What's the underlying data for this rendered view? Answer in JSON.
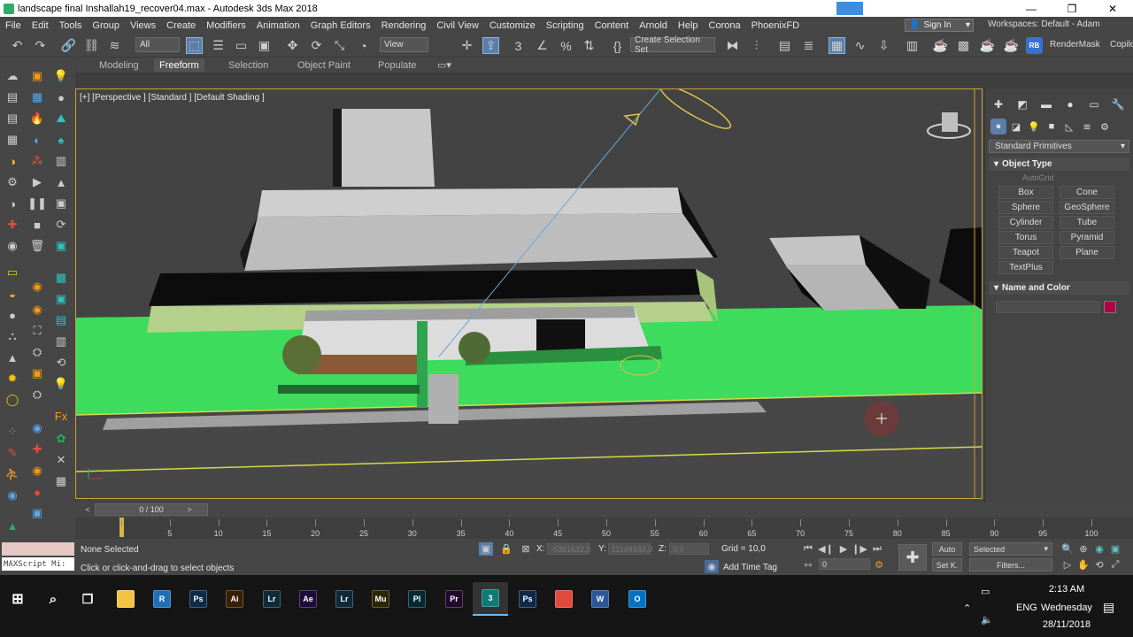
{
  "window": {
    "title": "landscape final Inshallah19_recover04.max - Autodesk 3ds Max 2018",
    "min": "—",
    "max": "❐",
    "close": "✕"
  },
  "menu": {
    "items": [
      "File",
      "Edit",
      "Tools",
      "Group",
      "Views",
      "Create",
      "Modifiers",
      "Animation",
      "Graph Editors",
      "Rendering",
      "Civil View",
      "Customize",
      "Scripting",
      "Content",
      "Arnold",
      "Help",
      "Corona",
      "PhoenixFD"
    ],
    "sign_in": "Sign In",
    "workspaces": "Workspaces: Default - Adam"
  },
  "toolbar": {
    "filter": "All",
    "view": "View",
    "selection_set": "Create Selection Set",
    "render_mask": "RenderMask",
    "copilot": "Copilo"
  },
  "ribbon": {
    "tabs": [
      "Modeling",
      "Freeform",
      "Selection",
      "Object Paint",
      "Populate"
    ]
  },
  "viewport": {
    "label": "[+] [Perspective ] [Standard ] [Default Shading ]",
    "ground_color": "#3ddc5c"
  },
  "command_panel": {
    "category": "Standard Primitives",
    "object_type": "Object Type",
    "autogrid": "AutoGrid",
    "buttons": [
      "Box",
      "Cone",
      "Sphere",
      "GeoSphere",
      "Cylinder",
      "Tube",
      "Torus",
      "Pyramid",
      "Teapot",
      "Plane",
      "TextPlus"
    ],
    "name_and_color": "Name and Color",
    "swatch_color": "#b0004e"
  },
  "timeline": {
    "frame": "0 / 100",
    "ticks": [
      "0",
      "5",
      "10",
      "15",
      "20",
      "25",
      "30",
      "35",
      "40",
      "45",
      "50",
      "55",
      "60",
      "65",
      "70",
      "75",
      "80",
      "85",
      "90",
      "95",
      "100"
    ]
  },
  "status": {
    "maxscript": "MAXScript Mi:",
    "selection": "None Selected",
    "prompt": "Click or click-and-drag to select objects",
    "x_label": "X:",
    "x_value": "-5361632,0",
    "y_label": "Y:",
    "y_value": "11149144,0",
    "z_label": "Z:",
    "z_value": "0,0",
    "grid": "Grid = 10,0",
    "add_time_tag": "Add Time Tag",
    "auto": "Auto",
    "selected": "Selected",
    "set_key": "Set K.",
    "filters": "Filters...",
    "frame_spinner": "0"
  },
  "taskbar": {
    "apps": [
      {
        "name": "file-explorer",
        "label": "",
        "color": "#f5c342"
      },
      {
        "name": "revit",
        "label": "R",
        "color": "#1f6fb7"
      },
      {
        "name": "photoshop",
        "label": "Ps",
        "color": "#0c2a4a"
      },
      {
        "name": "illustrator",
        "label": "Ai",
        "color": "#3a1e00"
      },
      {
        "name": "lightroom",
        "label": "Lr",
        "color": "#0f2a3a"
      },
      {
        "name": "after-effects",
        "label": "Ae",
        "color": "#1f0a3a"
      },
      {
        "name": "lightroom-2",
        "label": "Lr",
        "color": "#0f2a3a"
      },
      {
        "name": "muse",
        "label": "Mu",
        "color": "#2a2600"
      },
      {
        "name": "prelude",
        "label": "Pl",
        "color": "#002a33"
      },
      {
        "name": "premiere",
        "label": "Pr",
        "color": "#1f0a2a"
      },
      {
        "name": "3ds-max",
        "label": "3",
        "color": "#0e7b79"
      },
      {
        "name": "photoshop-2",
        "label": "Ps",
        "color": "#0c2a4a"
      },
      {
        "name": "chrome",
        "label": "",
        "color": "#e04a3a"
      },
      {
        "name": "word",
        "label": "W",
        "color": "#2b579a"
      },
      {
        "name": "outlook",
        "label": "O",
        "color": "#0072c6"
      }
    ],
    "time": "2:13 AM",
    "day": "Wednesday",
    "date": "28/11/2018",
    "lang": "ENG"
  }
}
